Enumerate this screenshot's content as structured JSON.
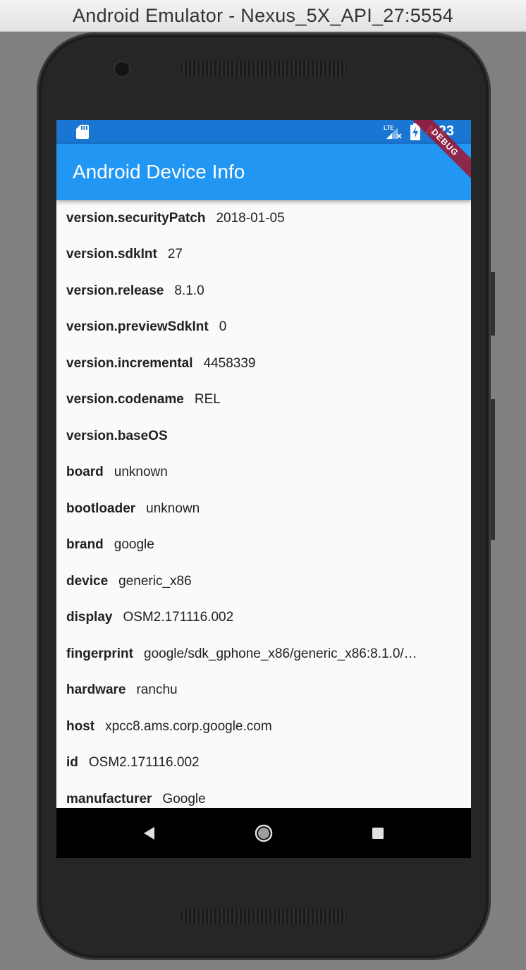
{
  "window": {
    "title": "Android Emulator - Nexus_5X_API_27:5554"
  },
  "status_bar": {
    "time": "4:23",
    "network": "LTE"
  },
  "app_bar": {
    "title": "Android Device Info"
  },
  "debug_banner": "DEBUG",
  "device_info": [
    {
      "key": "version.securityPatch",
      "value": "2018-01-05"
    },
    {
      "key": "version.sdkInt",
      "value": "27"
    },
    {
      "key": "version.release",
      "value": "8.1.0"
    },
    {
      "key": "version.previewSdkInt",
      "value": "0"
    },
    {
      "key": "version.incremental",
      "value": "4458339"
    },
    {
      "key": "version.codename",
      "value": "REL"
    },
    {
      "key": "version.baseOS",
      "value": ""
    },
    {
      "key": "board",
      "value": "unknown"
    },
    {
      "key": "bootloader",
      "value": "unknown"
    },
    {
      "key": "brand",
      "value": "google"
    },
    {
      "key": "device",
      "value": "generic_x86"
    },
    {
      "key": "display",
      "value": "OSM2.171116.002"
    },
    {
      "key": "fingerprint",
      "value": "google/sdk_gphone_x86/generic_x86:8.1.0/…"
    },
    {
      "key": "hardware",
      "value": "ranchu"
    },
    {
      "key": "host",
      "value": "xpcc8.ams.corp.google.com"
    },
    {
      "key": "id",
      "value": "OSM2.171116.002"
    },
    {
      "key": "manufacturer",
      "value": "Google"
    }
  ],
  "nav_bar": {
    "buttons": [
      "back-icon",
      "home-icon",
      "recents-icon"
    ]
  },
  "colors": {
    "status_bar": "#1976d2",
    "app_bar": "#2196f3",
    "background": "#fafafa"
  }
}
